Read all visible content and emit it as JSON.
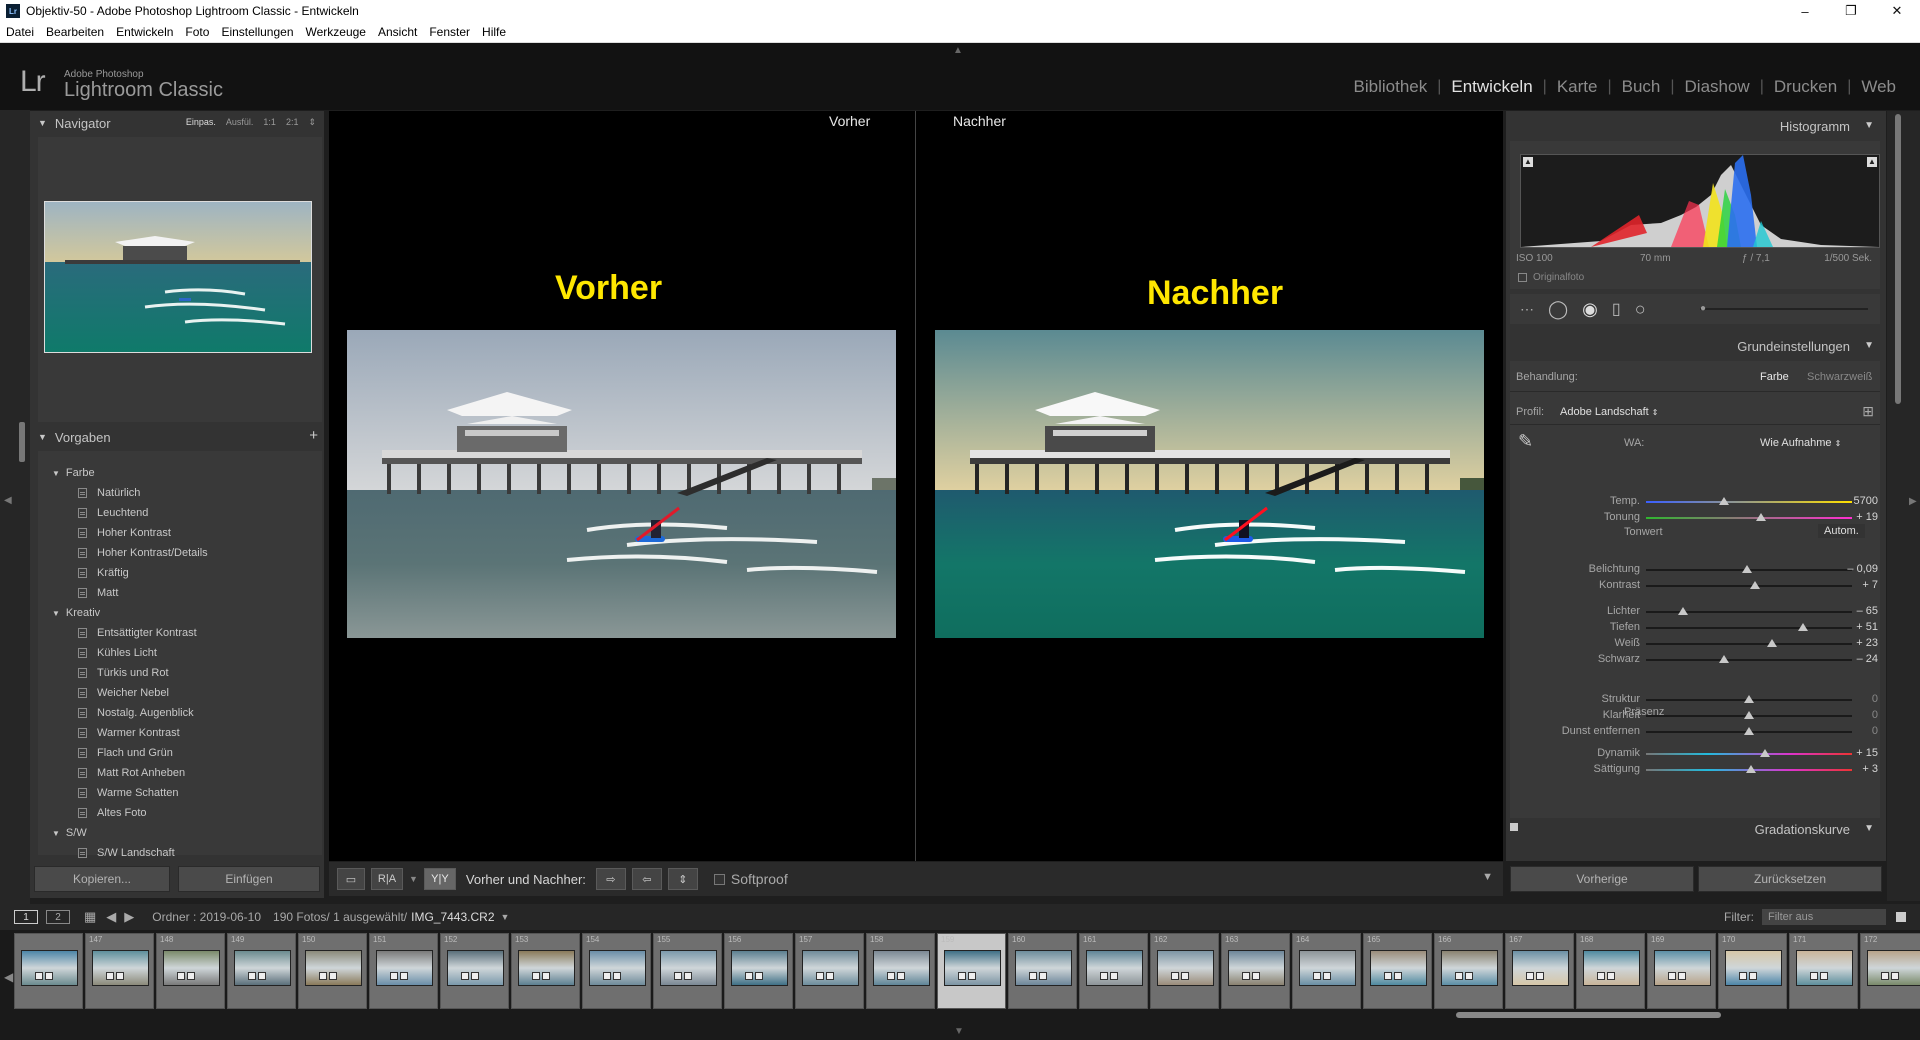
{
  "window": {
    "title": "Objektiv-50 - Adobe Photoshop Lightroom Classic - Entwickeln",
    "minimize": "–",
    "maximize": "❐",
    "close": "✕"
  },
  "menu": [
    "Datei",
    "Bearbeiten",
    "Entwickeln",
    "Foto",
    "Einstellungen",
    "Werkzeuge",
    "Ansicht",
    "Fenster",
    "Hilfe"
  ],
  "logo": {
    "lr": "Lr",
    "brand": "Adobe Photoshop",
    "product": "Lightroom Classic"
  },
  "modules": [
    "Bibliothek",
    "Entwickeln",
    "Karte",
    "Buch",
    "Diashow",
    "Drucken",
    "Web"
  ],
  "active_module": "Entwickeln",
  "navigator": {
    "title": "Navigator",
    "options": [
      "Einpas.",
      "Ausfül.",
      "1:1",
      "2:1"
    ],
    "selected": "Einpas."
  },
  "presets": {
    "title": "Vorgaben",
    "groups": [
      {
        "name": "Farbe",
        "items": [
          "Natürlich",
          "Leuchtend",
          "Hoher Kontrast",
          "Hoher Kontrast/Details",
          "Kräftig",
          "Matt"
        ]
      },
      {
        "name": "Kreativ",
        "items": [
          "Entsättigter Kontrast",
          "Kühles Licht",
          "Türkis und Rot",
          "Weicher Nebel",
          "Nostalg. Augenblick",
          "Warmer Kontrast",
          "Flach und Grün",
          "Matt Rot Anheben",
          "Warme Schatten",
          "Altes Foto"
        ]
      },
      {
        "name": "S/W",
        "items": [
          "S/W Landschaft"
        ]
      }
    ]
  },
  "left_buttons": {
    "copy": "Kopieren...",
    "paste": "Einfügen"
  },
  "center": {
    "before_label": "Vorher",
    "after_label": "Nachher",
    "before_big": "Vorher",
    "after_big": "Nachher"
  },
  "toolbar": {
    "view_icons": [
      "▭",
      "R|A",
      "Y|Y"
    ],
    "mode_label": "Vorher und Nachher:",
    "softproof": "Softproof"
  },
  "histogram": {
    "title": "Histogramm",
    "iso": "ISO 100",
    "focal": "70 mm",
    "aperture": "ƒ / 7,1",
    "shutter": "1/500 Sek.",
    "original": "Originalfoto"
  },
  "basic": {
    "title": "Grundeinstellungen",
    "treatment_label": "Behandlung:",
    "treatment_options": [
      "Farbe",
      "Schwarzweiß"
    ],
    "treatment_selected": "Farbe",
    "profile_label": "Profil:",
    "profile_value": "Adobe Landschaft",
    "wb_label": "WA:",
    "wb_value": "Wie Aufnahme",
    "tone_label": "Tonwert",
    "auto": "Autom.",
    "presence_label": "Präsenz",
    "sliders": [
      {
        "label": "Temp.",
        "value": "5700",
        "pos": 0.38,
        "grad": "linear-gradient(90deg,#3a5fff,#ffe000)"
      },
      {
        "label": "Tonung",
        "value": "+ 19",
        "pos": 0.56,
        "grad": "linear-gradient(90deg,#2fb52f,#ff2fd0)"
      },
      {
        "label": "Belichtung",
        "value": "– 0,09",
        "pos": 0.49,
        "grad": ""
      },
      {
        "label": "Kontrast",
        "value": "+ 7",
        "pos": 0.53,
        "grad": ""
      },
      {
        "label": "Lichter",
        "value": "– 65",
        "pos": 0.18,
        "grad": ""
      },
      {
        "label": "Tiefen",
        "value": "+ 51",
        "pos": 0.76,
        "grad": ""
      },
      {
        "label": "Weiß",
        "value": "+ 23",
        "pos": 0.61,
        "grad": ""
      },
      {
        "label": "Schwarz",
        "value": "– 24",
        "pos": 0.38,
        "grad": ""
      },
      {
        "label": "Struktur",
        "value": "0",
        "pos": 0.5,
        "grad": ""
      },
      {
        "label": "Klarheit",
        "value": "0",
        "pos": 0.5,
        "grad": ""
      },
      {
        "label": "Dunst entfernen",
        "value": "0",
        "pos": 0.5,
        "grad": ""
      },
      {
        "label": "Dynamik",
        "value": "+ 15",
        "pos": 0.58,
        "grad": "linear-gradient(90deg,#777,#2bd 30%,#d3c 70%,#e33)"
      },
      {
        "label": "Sättigung",
        "value": "+ 3",
        "pos": 0.51,
        "grad": "linear-gradient(90deg,#777,#2bd 30%,#d3c 70%,#e33)"
      }
    ]
  },
  "curve": {
    "title": "Gradationskurve"
  },
  "right_buttons": {
    "previous": "Vorherige",
    "reset": "Zurücksetzen"
  },
  "filmbar": {
    "page1": "1",
    "page2": "2",
    "folder": "Ordner : 2019-06-10",
    "count": "190 Fotos/ 1 ausgewählt/",
    "file": "IMG_7443.CR2",
    "filter_label": "Filter:",
    "filter_value": "Filter aus"
  },
  "filmstrip": {
    "numbers": [
      "",
      "147",
      "148",
      "149",
      "150",
      "151",
      "152",
      "153",
      "154",
      "155",
      "156",
      "157",
      "158",
      "159",
      "160",
      "161",
      "162",
      "163",
      "164",
      "165",
      "166",
      "167",
      "168",
      "169",
      "170",
      "171",
      "172"
    ],
    "selected": "159"
  }
}
